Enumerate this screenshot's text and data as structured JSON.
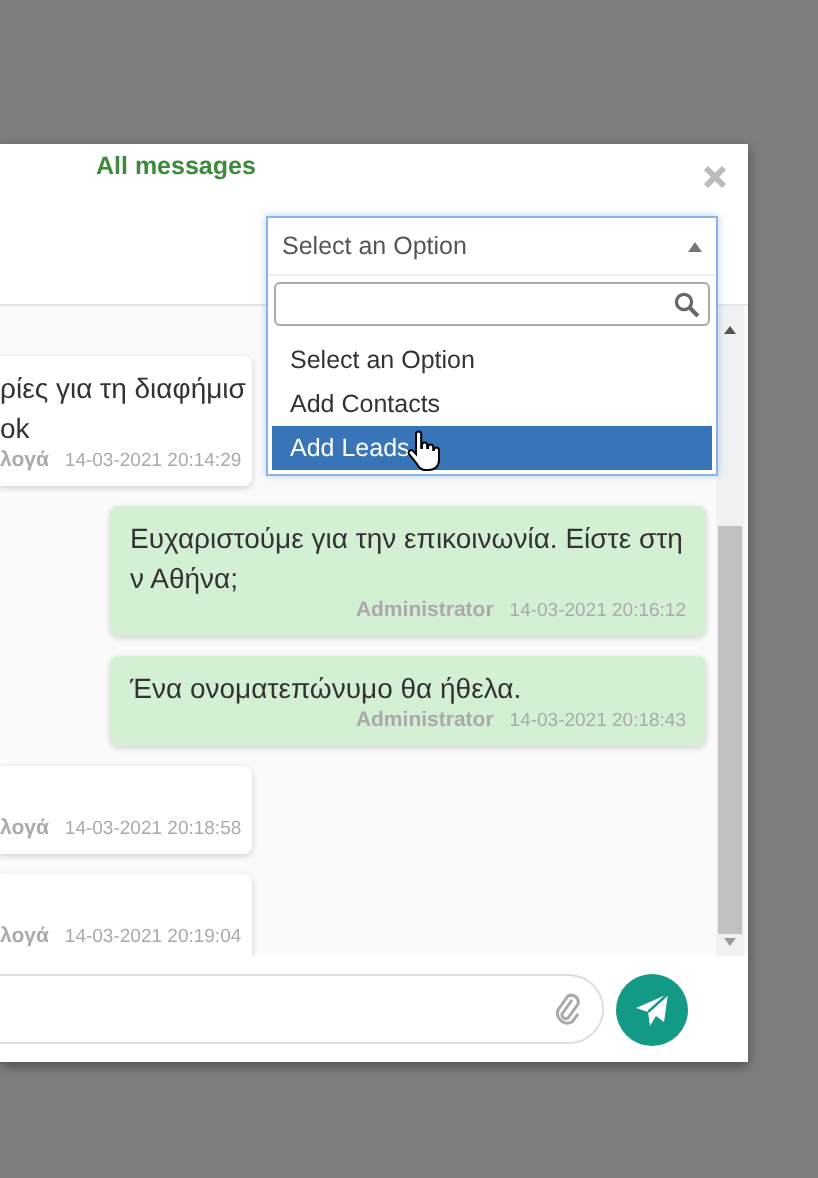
{
  "header": {
    "title": "All messages"
  },
  "dropdown": {
    "value": "Select an Option",
    "expanded": true,
    "options": [
      {
        "label": "Select an Option",
        "highlighted": false
      },
      {
        "label": "Add Contacts",
        "highlighted": false
      },
      {
        "label": "Add Leads",
        "highlighted": true
      }
    ]
  },
  "messages": [
    {
      "kind": "incoming",
      "lines": [
        "ρίες για τη διαφήμισ",
        "ok"
      ],
      "sender": "λογά",
      "time": "14-03-2021 20:14:29"
    },
    {
      "kind": "outgoing",
      "lines": [
        "Ευχαριστούμε για την επικοινωνία. Είστε στη",
        "ν Αθήνα;"
      ],
      "sender": "Administrator",
      "time": "14-03-2021 20:16:12"
    },
    {
      "kind": "outgoing",
      "lines": [
        "Ένα ονοματεπώνυμο θα ήθελα."
      ],
      "sender": "Administrator",
      "time": "14-03-2021 20:18:43"
    },
    {
      "kind": "incoming",
      "sender": "λογά",
      "time": "14-03-2021 20:18:58"
    },
    {
      "kind": "incoming",
      "sender": "λογά",
      "time": "14-03-2021 20:19:04"
    }
  ]
}
